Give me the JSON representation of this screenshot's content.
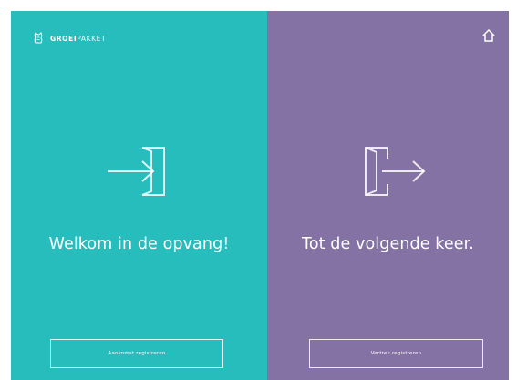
{
  "brand": {
    "name_strong": "GROEI",
    "name_light": "PAKKET",
    "logo_icon": "lion-crest-icon"
  },
  "header": {
    "home_icon": "home-icon"
  },
  "arrival": {
    "icon": "enter-door-icon",
    "title": "Welkom in de opvang!",
    "button_label": "Aankomst registreren",
    "color": "#27bdbd"
  },
  "departure": {
    "icon": "exit-door-icon",
    "title": "Tot de volgende keer.",
    "button_label": "Vertrek registreren",
    "color": "#8472a4"
  }
}
